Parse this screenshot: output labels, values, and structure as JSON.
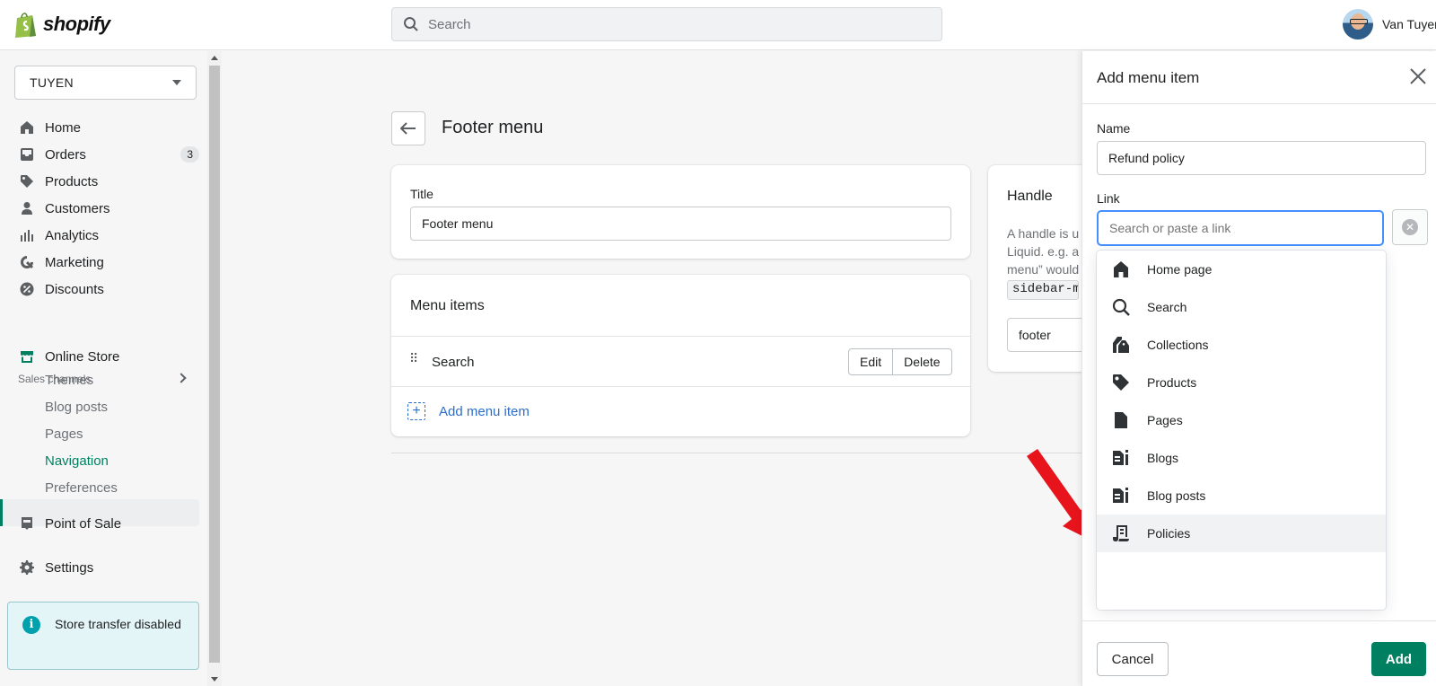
{
  "brand": {
    "name": "shopify",
    "accent": "#008060",
    "link": "#2c6ecb"
  },
  "search": {
    "placeholder": "Search"
  },
  "user": {
    "name": "Van Tuyen"
  },
  "sidebar": {
    "store": "TUYEN",
    "items": [
      {
        "label": "Home",
        "icon": "home-icon"
      },
      {
        "label": "Orders",
        "icon": "orders-icon",
        "badge": "3"
      },
      {
        "label": "Products",
        "icon": "tag-icon"
      },
      {
        "label": "Customers",
        "icon": "person-icon"
      },
      {
        "label": "Analytics",
        "icon": "bar-chart-icon"
      },
      {
        "label": "Marketing",
        "icon": "marketing-icon"
      },
      {
        "label": "Discounts",
        "icon": "discount-icon"
      }
    ],
    "sales_channels_title": "Sales channels",
    "online_store": {
      "label": "Online Store",
      "icon": "store-icon"
    },
    "sub_items": [
      "Themes",
      "Blog posts",
      "Pages",
      "Navigation",
      "Preferences"
    ],
    "active_sub": "Navigation",
    "pos": {
      "label": "Point of Sale",
      "icon": "pos-icon"
    },
    "settings": {
      "label": "Settings",
      "icon": "gear-icon"
    },
    "transfer_notice": "Store transfer disabled"
  },
  "main": {
    "title": "Footer menu",
    "title_card": {
      "label": "Title",
      "value": "Footer menu"
    },
    "menu_items_card": {
      "heading": "Menu items",
      "rows": [
        {
          "label": "Search",
          "edit": "Edit",
          "delete": "Delete"
        }
      ],
      "add_label": "Add menu item"
    },
    "handle_card": {
      "heading": "Handle",
      "description_lines": [
        "A handle is u",
        "Liquid. e.g. a",
        "menu” would"
      ],
      "code": "sidebar-m",
      "value": "footer"
    }
  },
  "panel": {
    "title": "Add menu item",
    "name_label": "Name",
    "name_value": "Refund policy",
    "link_label": "Link",
    "link_placeholder": "Search or paste a link",
    "options": [
      {
        "label": "Home page",
        "icon": "home-icon"
      },
      {
        "label": "Search",
        "icon": "search-icon"
      },
      {
        "label": "Collections",
        "icon": "collections-icon"
      },
      {
        "label": "Products",
        "icon": "tag-icon"
      },
      {
        "label": "Pages",
        "icon": "page-icon"
      },
      {
        "label": "Blogs",
        "icon": "blog-icon"
      },
      {
        "label": "Blog posts",
        "icon": "blog-icon"
      },
      {
        "label": "Policies",
        "icon": "policy-icon"
      }
    ],
    "highlighted_option": "Policies",
    "cancel_label": "Cancel",
    "add_label": "Add"
  },
  "annotation": {
    "arrow_color": "#e8141c"
  }
}
